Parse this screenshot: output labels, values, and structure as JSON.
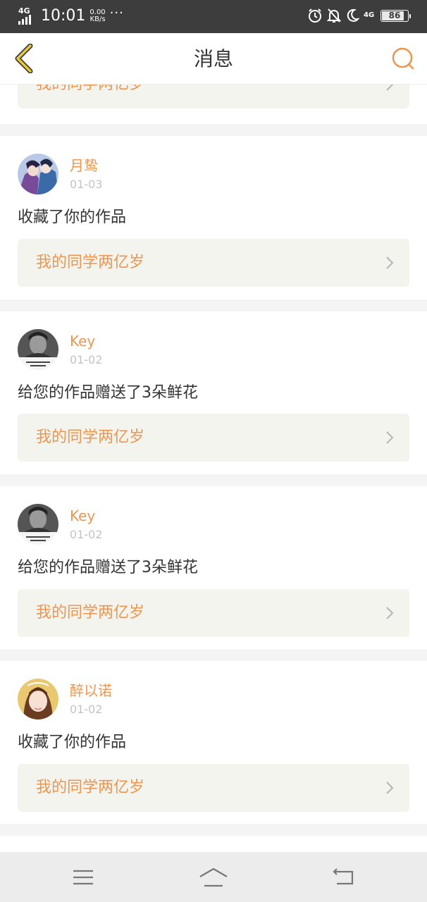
{
  "status_bar": {
    "network": "4G",
    "time": "10:01",
    "speed_value": "0.00",
    "speed_unit": "KB/s",
    "more": "···",
    "network2": "4G",
    "battery": "86",
    "battery_level": 0.86
  },
  "header": {
    "title": "消息",
    "back_icon": "chevron-left-icon",
    "search_icon": "search-icon"
  },
  "colors": {
    "accent": "#ee9550",
    "link_bg": "#f4f4ee",
    "back_arrow": "#e0c23a"
  },
  "messages": [
    {
      "work_title": "我的同学两亿岁"
    },
    {
      "user": "月鸷",
      "date": "01-03",
      "text": "收藏了你的作品",
      "work_title": "我的同学两亿岁"
    },
    {
      "user": "Key",
      "date": "01-02",
      "text": "给您的作品赠送了3朵鲜花",
      "work_title": "我的同学两亿岁"
    },
    {
      "user": "Key",
      "date": "01-02",
      "text": "给您的作品赠送了3朵鲜花",
      "work_title": "我的同学两亿岁"
    },
    {
      "user": "醉以诺",
      "date": "01-02",
      "text": "收藏了你的作品",
      "work_title": "我的同学两亿岁"
    }
  ],
  "nav_bar": {
    "menu_icon": "menu-icon",
    "home_icon": "home-icon",
    "back_icon": "back-icon"
  }
}
